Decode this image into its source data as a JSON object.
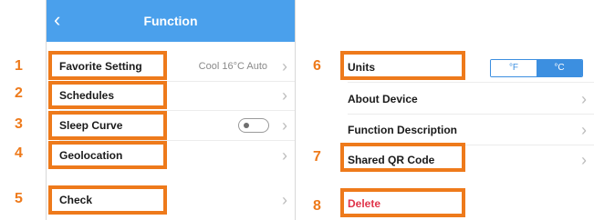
{
  "left_screen": {
    "header": {
      "back_glyph": "‹",
      "title": "Function"
    },
    "rows": [
      {
        "label": "Favorite Setting",
        "value": "Cool 16°C Auto"
      },
      {
        "label": "Schedules",
        "value": ""
      },
      {
        "label": "Sleep Curve",
        "value": "",
        "toggle_on": false
      },
      {
        "label": "Geolocation",
        "value": ""
      },
      {
        "label": "Check",
        "value": ""
      }
    ]
  },
  "right_screen": {
    "units": {
      "label": "Units",
      "options": [
        "°F",
        "°C"
      ],
      "selected": "°C"
    },
    "rows": [
      {
        "label": "About Device"
      },
      {
        "label": "Function Description"
      },
      {
        "label": "Shared QR Code"
      },
      {
        "label": "Delete"
      }
    ]
  },
  "markers": [
    "1",
    "2",
    "3",
    "4",
    "5",
    "6",
    "7",
    "8"
  ],
  "colors": {
    "accent": "#4aa0ec",
    "highlight": "#ee7a1b",
    "danger": "#e0344a"
  },
  "icons": {
    "chevron": "›"
  }
}
